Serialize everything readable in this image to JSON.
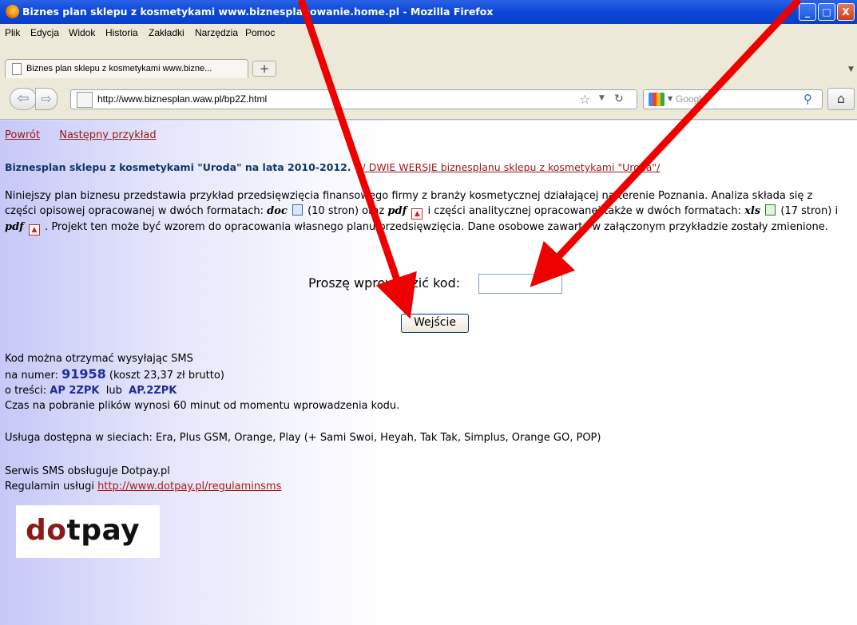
{
  "window": {
    "title": "Biznes plan sklepu z kosmetykami www.biznesplanowanie.home.pl - Mozilla Firefox",
    "controls": {
      "minimize": "_",
      "maximize": "□",
      "close": "X"
    }
  },
  "menu": [
    "Plik",
    "Edycja",
    "Widok",
    "Historia",
    "Zakładki",
    "Narzędzia",
    "Pomoc"
  ],
  "tab": {
    "label": "Biznes plan sklepu z kosmetykami www.bizne...",
    "close": "×",
    "new_tab": "+"
  },
  "nav": {
    "url": "http://www.biznesplan.waw.pl/bp2Z.html",
    "search_placeholder": "Google",
    "back": "◀",
    "forward": "▶",
    "reload": "C",
    "home": "⌂"
  },
  "page": {
    "links": {
      "back": "Powrót",
      "next": "Następny przykład"
    },
    "headline": {
      "title": "Biznesplan sklepu z kosmetykami \"Uroda\" na lata 2010-2012.",
      "link": "/ DWIE WERSJE biznesplanu sklepu z kosmetykami \"Uroda\"/"
    },
    "intro": {
      "p1": "Niniejszy plan biznesu przedstawia przykład przedsięwzięcia finansowego firmy z branży kosmetycznej działającej na terenie Poznania. Analiza składa się z części opisowej opracowanej  w dwóch   formatach: ",
      "doc": "doc",
      "p2": " (10 stron) oraz ",
      "pdf": "pdf",
      "p3": "  i części analitycznej opracowanej także w dwóch formatach: ",
      "xls": "xls",
      "p4": "  (17 stron) i ",
      "pdf2": "pdf",
      "p5": " . Projekt ten może być wzorem do opracowania własnego planu przedsięwzięcia. Dane osobowe zawarte w załączonym przykładzie zostały zmienione."
    },
    "form": {
      "label": "Proszę  wprowadzić kod:",
      "code_value": "",
      "submit": "Wejście"
    },
    "sms": {
      "line1": "Kod można otrzymać wysyłając SMS",
      "number_prefix": "na numer: ",
      "number": "91958",
      "cost": " (koszt 23,37 zł brutto)",
      "content_prefix": "o treści: ",
      "kw1": "AP 2ZPK",
      "or": "  lub  ",
      "kw2": "AP.2ZPK",
      "time": "Czas na pobranie plików wynosi 60 minut od momentu wprowadzenia kodu."
    },
    "availability": "Usługa dostępna w sieciach: Era, Plus GSM, Orange, Play (+ Sami Swoi, Heyah, Tak Tak, Simplus, Orange GO, POP)",
    "service": {
      "line1": "Serwis SMS obsługuje Dotpay.pl",
      "rules_prefix": "Regulamin usługi ",
      "rules_link": "http://www.dotpay.pl/regulaminsms"
    },
    "logo": {
      "part1": "d",
      "part2": "tpay",
      "dot": "o"
    }
  },
  "colors": {
    "arrow": "#ee0000",
    "link": "#9b1818",
    "headline": "#11356f",
    "accent": "#1f2c9b"
  }
}
